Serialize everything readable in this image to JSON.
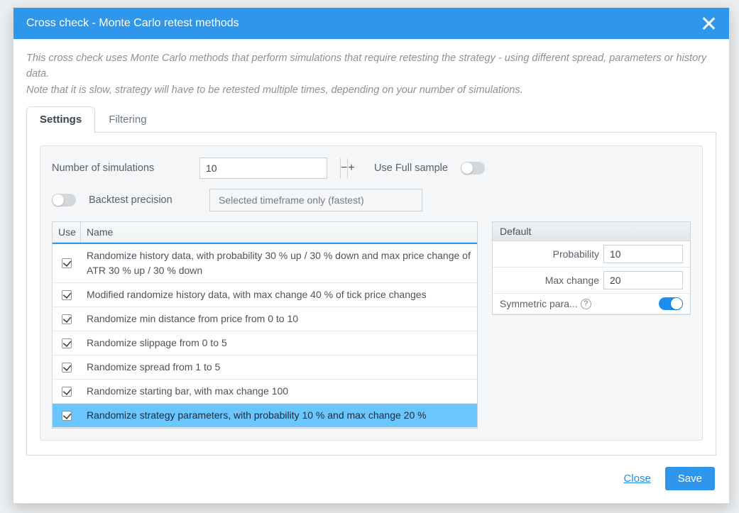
{
  "window": {
    "title": "Cross check - Monte Carlo retest methods"
  },
  "description": {
    "line1": "This cross check uses Monte Carlo methods that perform simulations that require retesting the strategy - using different spread, parameters or history data.",
    "line2": "Note that it is slow, strategy will have to be retested multiple times, depending on your number of simulations."
  },
  "tabs": {
    "settings": "Settings",
    "filtering": "Filtering"
  },
  "form": {
    "num_sim_label": "Number of simulations",
    "num_sim_value": "10",
    "full_sample_label": "Use Full sample",
    "backtest_precision_label": "Backtest precision",
    "backtest_precision_value": "Selected timeframe only (fastest)"
  },
  "table": {
    "head_use": "Use",
    "head_name": "Name",
    "rows": [
      {
        "name": "Randomize history data, with probability 30 % up / 30 % down and max price change of ATR 30 % up / 30 % down",
        "selected": false
      },
      {
        "name": "Modified randomize history data, with max change 40 % of tick price changes",
        "selected": false
      },
      {
        "name": "Randomize min distance from price from 0 to 10",
        "selected": false
      },
      {
        "name": "Randomize slippage from 0 to 5",
        "selected": false
      },
      {
        "name": "Randomize spread from 1 to 5",
        "selected": false
      },
      {
        "name": "Randomize starting bar, with max change 100",
        "selected": false
      },
      {
        "name": "Randomize strategy parameters, with probability 10 % and max change 20 %",
        "selected": true
      }
    ]
  },
  "detail": {
    "header": "Default",
    "probability_label": "Probability",
    "probability_value": "10",
    "max_change_label": "Max change",
    "max_change_value": "20",
    "symmetric_label": "Symmetric para..."
  },
  "footer": {
    "close": "Close",
    "save": "Save"
  },
  "glyphs": {
    "minus": "−",
    "plus": "+",
    "question": "?"
  }
}
